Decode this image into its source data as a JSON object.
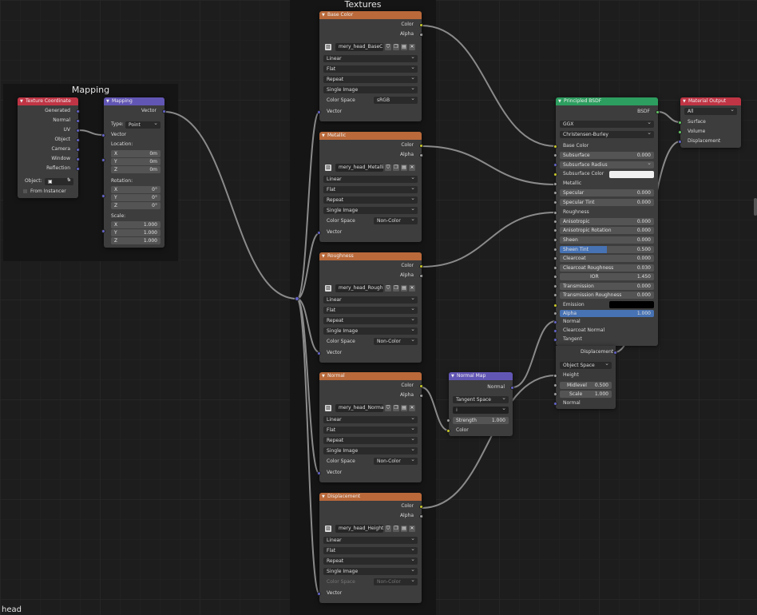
{
  "frames": {
    "mapping_title": "Mapping",
    "textures_title": "Textures"
  },
  "editor": {
    "material_name": "head"
  },
  "texture_coordinate": {
    "title": "Texture Coordinate",
    "outputs": [
      "Generated",
      "Normal",
      "UV",
      "Object",
      "Camera",
      "Window",
      "Reflection"
    ],
    "object_label": "Object:",
    "from_instancer": "From Instancer"
  },
  "mapping_node": {
    "title": "Mapping",
    "output": "Vector",
    "type_label": "Type:",
    "type_value": "Point",
    "vector_input": "Vector",
    "location_label": "Location:",
    "location": [
      {
        "axis": "X",
        "value": "0m"
      },
      {
        "axis": "Y",
        "value": "0m"
      },
      {
        "axis": "Z",
        "value": "0m"
      }
    ],
    "rotation_label": "Rotation:",
    "rotation": [
      {
        "axis": "X",
        "value": "0°"
      },
      {
        "axis": "Y",
        "value": "0°"
      },
      {
        "axis": "Z",
        "value": "0°"
      }
    ],
    "scale_label": "Scale:",
    "scale": [
      {
        "axis": "X",
        "value": "1.000"
      },
      {
        "axis": "Y",
        "value": "1.000"
      },
      {
        "axis": "Z",
        "value": "1.000"
      }
    ]
  },
  "image_nodes": [
    {
      "title": "Base Color",
      "image": "mery_head_BaseC...",
      "interp": "Linear",
      "proj": "Flat",
      "ext": "Repeat",
      "source": "Single Image",
      "cs_label": "Color Space",
      "cs_value": "sRGB",
      "out_color": "Color",
      "out_alpha": "Alpha",
      "in_vector": "Vector"
    },
    {
      "title": "Metallic",
      "image": "mery_head_Metallic...",
      "interp": "Linear",
      "proj": "Flat",
      "ext": "Repeat",
      "source": "Single Image",
      "cs_label": "Color Space",
      "cs_value": "Non-Color",
      "out_color": "Color",
      "out_alpha": "Alpha",
      "in_vector": "Vector"
    },
    {
      "title": "Roughness",
      "image": "mery_head_Roughn...",
      "interp": "Linear",
      "proj": "Flat",
      "ext": "Repeat",
      "source": "Single Image",
      "cs_label": "Color Space",
      "cs_value": "Non-Color",
      "out_color": "Color",
      "out_alpha": "Alpha",
      "in_vector": "Vector"
    },
    {
      "title": "Normal",
      "image": "mery_head_Normal...",
      "interp": "Linear",
      "proj": "Flat",
      "ext": "Repeat",
      "source": "Single Image",
      "cs_label": "Color Space",
      "cs_value": "Non-Color",
      "out_color": "Color",
      "out_alpha": "Alpha",
      "in_vector": "Vector"
    },
    {
      "title": "Displacement",
      "image": "mery_head_Height...",
      "interp": "Linear",
      "proj": "Flat",
      "ext": "Repeat",
      "source": "Single Image",
      "cs_label": "Color Space",
      "cs_value": "Non-Color",
      "out_color": "Color",
      "out_alpha": "Alpha",
      "in_vector": "Vector"
    }
  ],
  "normal_map": {
    "title": "Normal Map",
    "output": "Normal",
    "space": "Tangent Space",
    "uv_value": "",
    "strength_label": "Strength",
    "strength_value": "1.000",
    "color_input": "Color"
  },
  "principled": {
    "title": "Principled BSDF",
    "output": "BSDF",
    "distribution": "GGX",
    "subsurface_method": "Christensen-Burley",
    "base_color": "Base Color",
    "subsurface": {
      "label": "Subsurface",
      "value": "0.000"
    },
    "subsurface_radius": "Subsurface Radius",
    "subsurface_color": "Subsurface Color",
    "metallic": "Metallic",
    "specular": {
      "label": "Specular",
      "value": "0.000"
    },
    "specular_tint": {
      "label": "Specular Tint",
      "value": "0.000"
    },
    "roughness": "Roughness",
    "anisotropic": {
      "label": "Anisotropic",
      "value": "0.000"
    },
    "anisotropic_rotation": {
      "label": "Anisotropic Rotation",
      "value": "0.000"
    },
    "sheen": {
      "label": "Sheen",
      "value": "0.000"
    },
    "sheen_tint": {
      "label": "Sheen Tint",
      "value": "0.500",
      "fraction": 0.5
    },
    "clearcoat": {
      "label": "Clearcoat",
      "value": "0.000"
    },
    "clearcoat_roughness": {
      "label": "Clearcoat Roughness",
      "value": "0.030"
    },
    "ior": {
      "label": "IOR",
      "value": "1.450"
    },
    "transmission": {
      "label": "Transmission",
      "value": "0.000"
    },
    "transmission_roughness": {
      "label": "Transmission Roughness",
      "value": "0.000"
    },
    "emission": "Emission",
    "alpha": {
      "label": "Alpha",
      "value": "1.000",
      "fraction": 1.0
    },
    "normal": "Normal",
    "clearcoat_normal": "Clearcoat Normal",
    "tangent": "Tangent"
  },
  "displacement_node": {
    "title": "Displacement",
    "space": "Object Space",
    "height": "Height",
    "midlevel": {
      "label": "Midlevel",
      "value": "0.500"
    },
    "scale": {
      "label": "Scale",
      "value": "1.000"
    },
    "normal": "Normal"
  },
  "material_output": {
    "title": "Material Output",
    "target": "All",
    "inputs": [
      "Surface",
      "Volume",
      "Displacement"
    ]
  },
  "colors": {
    "texture_header": "#b9693a",
    "vector_header": "#6256b5",
    "shader_header": "#2d9e5f",
    "output_header": "#c03545",
    "color_socket": "#c7c729",
    "float_socket": "#9e9e9e",
    "vector_socket": "#6363c7",
    "shader_socket": "#63c763",
    "slider_blue": "#4772b3",
    "subsurface_color_swatch": "#f0f0f0",
    "emission_swatch": "#000000"
  }
}
